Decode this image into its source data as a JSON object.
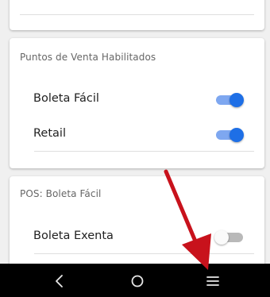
{
  "sections": {
    "puntos_venta": {
      "title": "Puntos de Venta Habilitados",
      "items": [
        {
          "label": "Boleta Fácil",
          "enabled": true
        },
        {
          "label": "Retail",
          "enabled": true
        }
      ]
    },
    "pos": {
      "title": "POS: Boleta Fácil",
      "items": [
        {
          "label": "Boleta Exenta",
          "enabled": false
        }
      ]
    }
  },
  "colors": {
    "toggle_on_thumb": "#1e6fe6",
    "toggle_on_track": "#7ea7f0",
    "toggle_off_track": "#b9b9b9",
    "annotation_arrow": "#c8121c"
  },
  "navbar": {
    "icons": [
      "back-icon",
      "home-icon",
      "menu-icon"
    ]
  }
}
